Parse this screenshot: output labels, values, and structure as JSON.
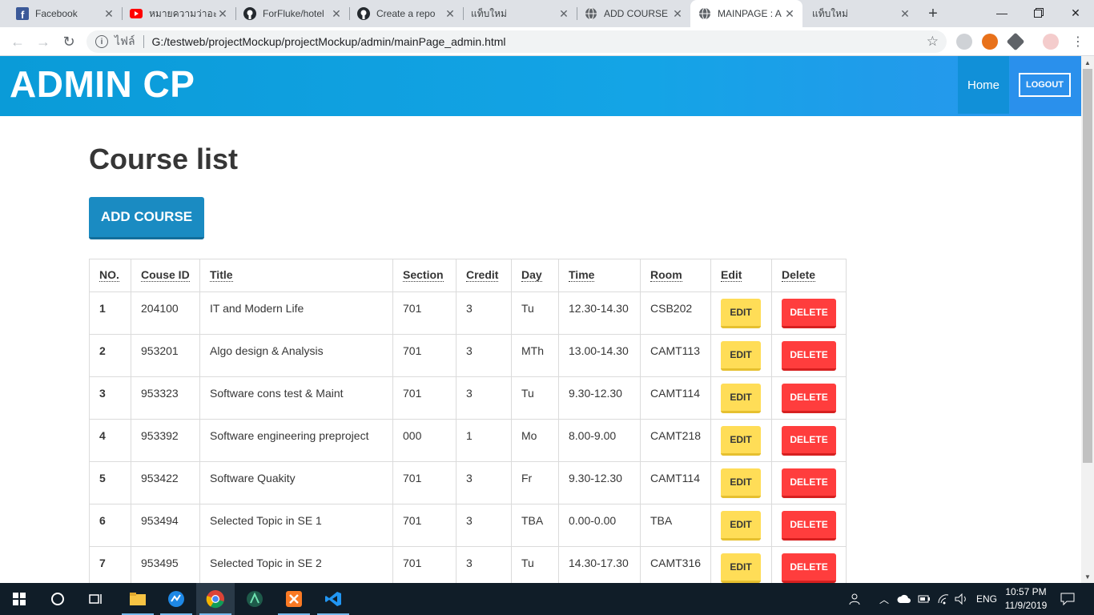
{
  "browser": {
    "tabs": [
      {
        "title": "Facebook",
        "icon": "facebook-icon"
      },
      {
        "title": "หมายความว่าอะไร",
        "icon": "youtube-icon"
      },
      {
        "title": "ForFluke/hotel",
        "icon": "github-icon"
      },
      {
        "title": "Create a repo",
        "icon": "github-icon"
      },
      {
        "title": "แท็บใหม่",
        "icon": ""
      },
      {
        "title": "ADD COURSE",
        "icon": "globe-icon"
      },
      {
        "title": "MAINPAGE : A",
        "icon": "globe-icon"
      },
      {
        "title": "แท็บใหม่",
        "icon": ""
      }
    ],
    "active_tab": 6,
    "address": {
      "scheme_label": "ไฟล์",
      "url": "G:/testweb/projectMockup/projectMockup/admin/mainPage_admin.html"
    }
  },
  "header": {
    "brand": "ADMIN CP",
    "nav_home": "Home",
    "logout": "LOGOUT"
  },
  "main": {
    "title": "Course list",
    "add_button": "ADD COURSE",
    "table": {
      "columns": [
        "NO.",
        "Couse ID",
        "Title",
        "Section",
        "Credit",
        "Day",
        "Time",
        "Room",
        "Edit",
        "Delete"
      ],
      "rows": [
        [
          "1",
          "204100",
          "IT and Modern Life",
          "701",
          "3",
          "Tu",
          "12.30-14.30",
          "CSB202"
        ],
        [
          "2",
          "953201",
          "Algo design & Analysis",
          "701",
          "3",
          "MTh",
          "13.00-14.30",
          "CAMT113"
        ],
        [
          "3",
          "953323",
          "Software cons test & Maint",
          "701",
          "3",
          "Tu",
          "9.30-12.30",
          "CAMT114"
        ],
        [
          "4",
          "953392",
          "Software engineering preproject",
          "000",
          "1",
          "Mo",
          "8.00-9.00",
          "CAMT218"
        ],
        [
          "5",
          "953422",
          "Software Quakity",
          "701",
          "3",
          "Fr",
          "9.30-12.30",
          "CAMT114"
        ],
        [
          "6",
          "953494",
          "Selected Topic in SE 1",
          "701",
          "3",
          "TBA",
          "0.00-0.00",
          "TBA"
        ],
        [
          "7",
          "953495",
          "Selected Topic in SE 2",
          "701",
          "3",
          "Tu",
          "14.30-17.30",
          "CAMT316"
        ]
      ],
      "edit_label": "EDIT",
      "delete_label": "DELETE"
    }
  },
  "taskbar": {
    "language": "ENG",
    "time": "10:57 PM",
    "date": "11/9/2019"
  },
  "colors": {
    "header_start": "#0a9bd8",
    "header_end": "#2a95ee",
    "add_button": "#1a8bc2",
    "edit_button": "#ffdd57",
    "delete_button": "#ff3d3d"
  }
}
